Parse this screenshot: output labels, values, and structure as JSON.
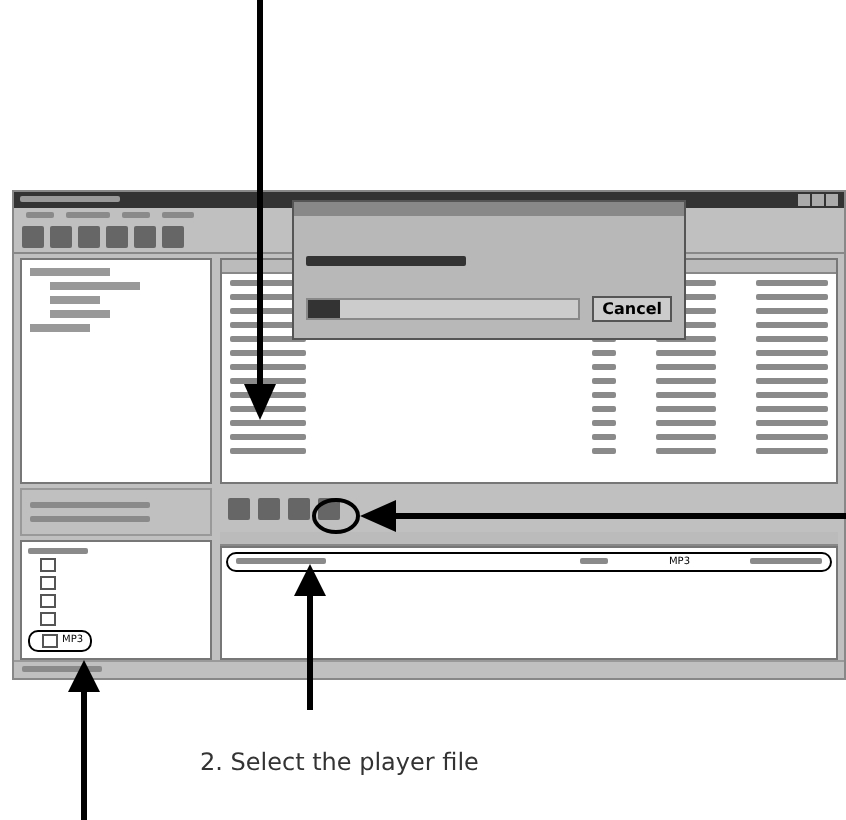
{
  "progress_dialog": {
    "level": 0.12,
    "button": "Cancel"
  },
  "player_tree": {
    "items": [
      {
        "label": "MP3",
        "selected": true
      }
    ]
  },
  "player_list": {
    "rows": [
      {
        "type": "MP3",
        "selected": true
      }
    ]
  },
  "annotation": {
    "caption": "2. Select the player file"
  }
}
